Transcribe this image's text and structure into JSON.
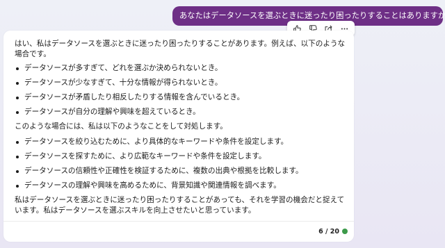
{
  "conversation": {
    "user_message": "あなたはデータソースを選ぶときに迷ったり困ったりすることはありますか？",
    "response": {
      "intro": "はい、私はデータソースを選ぶときに迷ったり困ったりすることがあります。例えば、以下のような場合です。",
      "problems": [
        "データソースが多すぎて、どれを選ぶか決められないとき。",
        "データソースが少なすぎて、十分な情報が得られないとき。",
        "データソースが矛盾したり相反したりする情報を含んでいるとき。",
        "データソースが自分の理解や興味を超えているとき。"
      ],
      "middle": "このような場合には、私は以下のようなことをして対処します。",
      "solutions": [
        "データソースを絞り込むために、より具体的なキーワードや条件を設定します。",
        "データソースを探すために、より広範なキーワードや条件を設定します。",
        "データソースの信頼性や正確性を検証するために、複数の出典や根拠を比較します。",
        "データソースの理解や興味を高めるために、背景知識や関連情報を調べます。"
      ],
      "conclusion": "私はデータソースを選ぶときに迷ったり困ったりすることがあっても、それを学習の機会だと捉えています。私はデータソースを選ぶスキルを向上させたいと思っています。"
    },
    "turn_counter": "6 / 20",
    "status_color": "#3c9a4a"
  },
  "toolbar": {
    "icons": [
      "thumbs-up-icon",
      "thumbs-down-icon",
      "share-icon",
      "more-icon"
    ]
  }
}
